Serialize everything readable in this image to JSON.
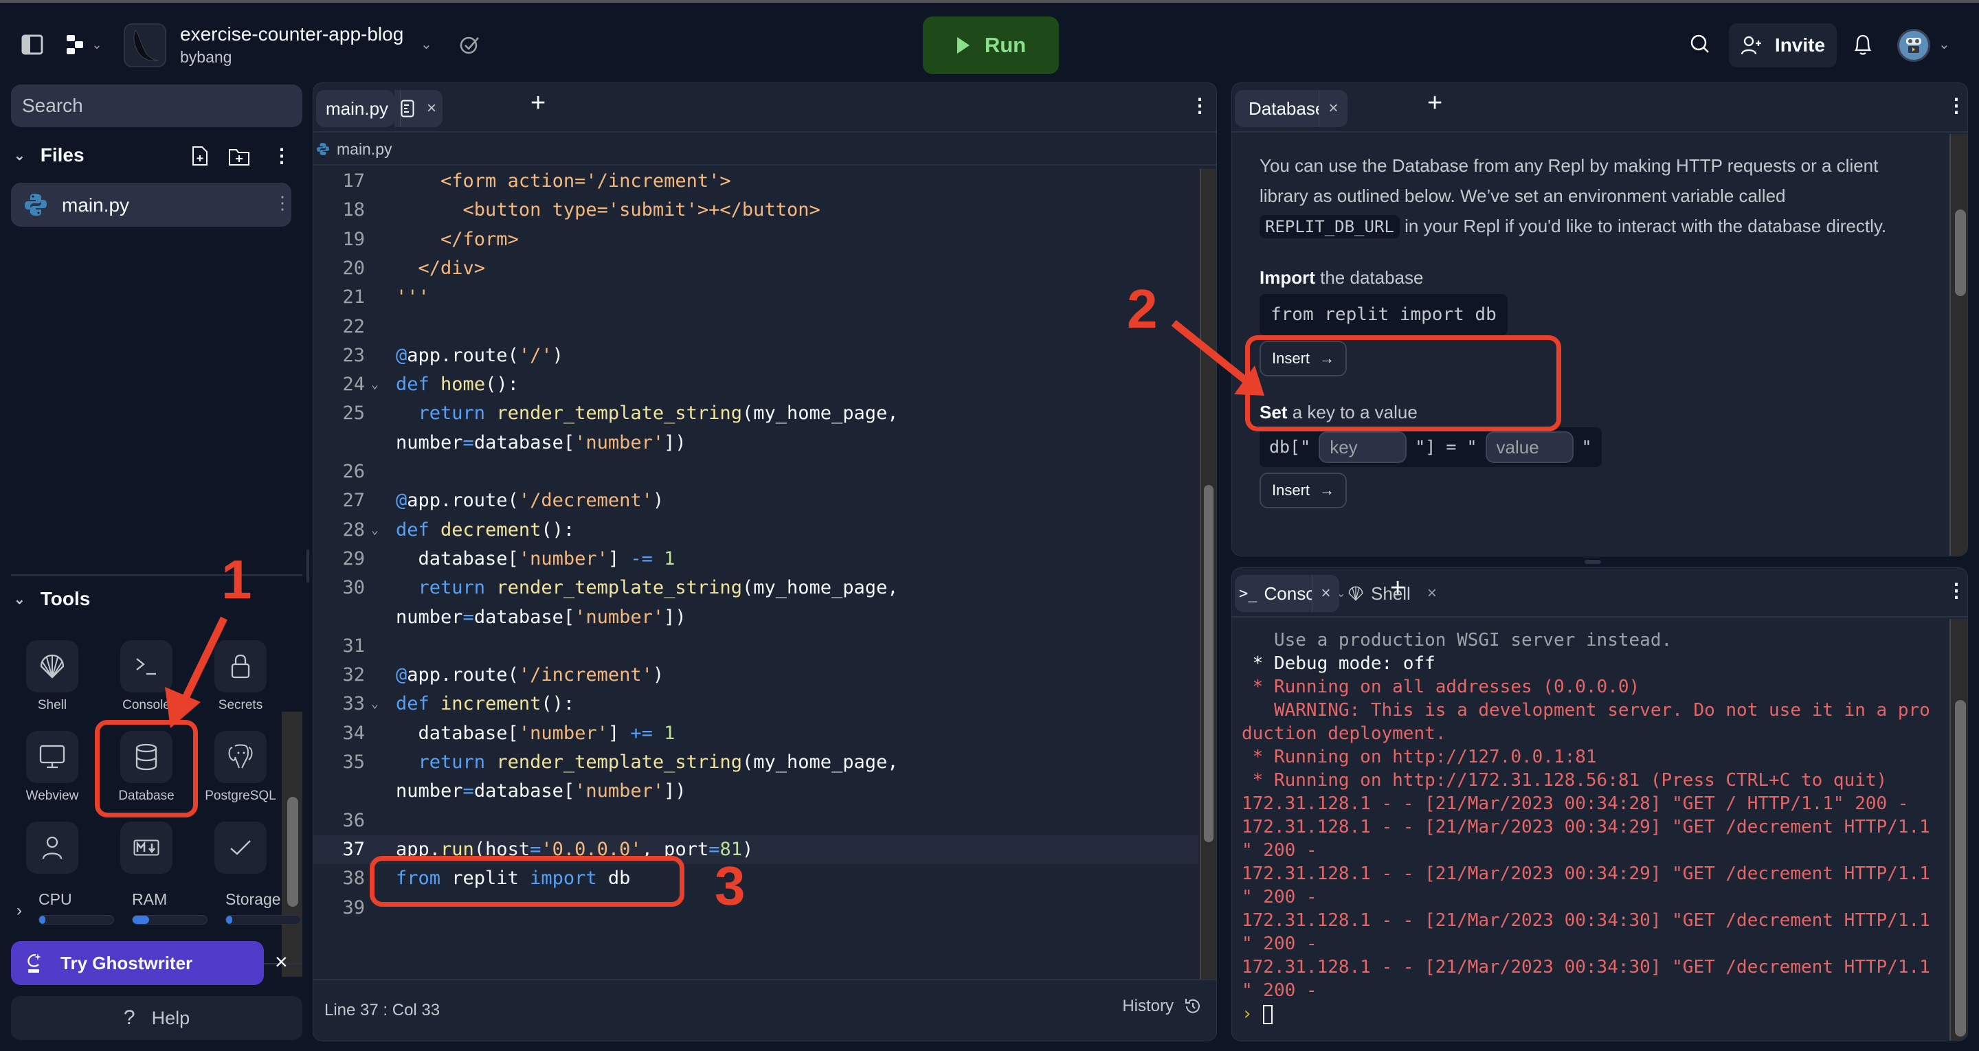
{
  "topbar": {
    "repl_title": "exercise-counter-app-blog",
    "repl_owner": "bybang",
    "run_label": "Run",
    "invite_label": "Invite",
    "icons": [
      "sidebar-toggle-icon",
      "replit-logo-icon",
      "chevron-down-icon",
      "flask-icon",
      "cloud-check-icon",
      "search-icon",
      "user-plus-icon",
      "bell-icon",
      "user-avatar"
    ]
  },
  "sidebar": {
    "search_placeholder": "Search",
    "files_heading": "Files",
    "files": [
      {
        "name": "main.py",
        "icon": "python-icon"
      }
    ],
    "tools_heading": "Tools",
    "tools": [
      {
        "label": "Shell",
        "icon": "shell-icon"
      },
      {
        "label": "Console",
        "icon": "terminal-icon"
      },
      {
        "label": "Secrets",
        "icon": "lock-icon"
      },
      {
        "label": "Webview",
        "icon": "monitor-icon"
      },
      {
        "label": "Database",
        "icon": "database-icon"
      },
      {
        "label": "PostgreSQL",
        "icon": "postgresql-icon"
      },
      {
        "label": "",
        "icon": "user-icon"
      },
      {
        "label": "",
        "icon": "markdown-icon"
      },
      {
        "label": "",
        "icon": "check-icon"
      }
    ],
    "resources": [
      {
        "label": "CPU",
        "percent": 3
      },
      {
        "label": "RAM",
        "percent": 22
      },
      {
        "label": "Storage",
        "percent": 3
      }
    ],
    "ghostwriter_label": "Try Ghostwriter",
    "help_label": "Help"
  },
  "editor": {
    "tab_label": "main.py",
    "breadcrumb": "main.py",
    "lines": [
      {
        "num": "17",
        "fold": "",
        "html": "    <span class=\"h\">&lt;form action='/increment'&gt;</span>"
      },
      {
        "num": "18",
        "fold": "",
        "html": "      <span class=\"h\">&lt;button type='submit'&gt;+&lt;/button&gt;</span>"
      },
      {
        "num": "19",
        "fold": "",
        "html": "    <span class=\"h\">&lt;/form&gt;</span>"
      },
      {
        "num": "20",
        "fold": "",
        "html": "  <span class=\"h\">&lt;/div&gt;</span>"
      },
      {
        "num": "21",
        "fold": "",
        "html": "<span class=\"h\">'''</span>"
      },
      {
        "num": "22",
        "fold": "",
        "html": ""
      },
      {
        "num": "23",
        "fold": "",
        "html": "<span class=\"k\">@</span>app.route(<span class=\"s\">'/'</span>)"
      },
      {
        "num": "24",
        "fold": "v",
        "html": "<span class=\"k\">def</span> <span class=\"f\">home</span>():"
      },
      {
        "num": "25",
        "fold": "",
        "html": "  <span class=\"k\">return</span> <span class=\"f\">render_template_string</span>(my_home_page,"
      },
      {
        "num": "",
        "fold": "",
        "html": "number<span class=\"op\">=</span>database[<span class=\"s\">'number'</span>])"
      },
      {
        "num": "26",
        "fold": "",
        "html": ""
      },
      {
        "num": "27",
        "fold": "",
        "html": "<span class=\"k\">@</span>app.route(<span class=\"s\">'/decrement'</span>)"
      },
      {
        "num": "28",
        "fold": "v",
        "html": "<span class=\"k\">def</span> <span class=\"f\">decrement</span>():"
      },
      {
        "num": "29",
        "fold": "",
        "html": "  database[<span class=\"s\">'number'</span>] <span class=\"op\">-=</span> <span class=\"n\">1</span>"
      },
      {
        "num": "30",
        "fold": "",
        "html": "  <span class=\"k\">return</span> <span class=\"f\">render_template_string</span>(my_home_page,"
      },
      {
        "num": "",
        "fold": "",
        "html": "number<span class=\"op\">=</span>database[<span class=\"s\">'number'</span>])"
      },
      {
        "num": "31",
        "fold": "",
        "html": ""
      },
      {
        "num": "32",
        "fold": "",
        "html": "<span class=\"k\">@</span>app.route(<span class=\"s\">'/increment'</span>)"
      },
      {
        "num": "33",
        "fold": "v",
        "html": "<span class=\"k\">def</span> <span class=\"f\">increment</span>():"
      },
      {
        "num": "34",
        "fold": "",
        "html": "  database[<span class=\"s\">'number'</span>] <span class=\"op\">+=</span> <span class=\"n\">1</span>"
      },
      {
        "num": "35",
        "fold": "",
        "html": "  <span class=\"k\">return</span> <span class=\"f\">render_template_string</span>(my_home_page,"
      },
      {
        "num": "",
        "fold": "",
        "html": "number<span class=\"op\">=</span>database[<span class=\"s\">'number'</span>])"
      },
      {
        "num": "36",
        "fold": "",
        "html": ""
      },
      {
        "num": "37",
        "fold": "",
        "html": "app.<span class=\"f\">run</span>(host<span class=\"op\">=</span><span class=\"s\">'0.0.0.0'</span>, port<span class=\"op\">=</span><span class=\"n\">81</span>)",
        "active": true
      },
      {
        "num": "38",
        "fold": "",
        "html": "<span class=\"k\">from</span> replit <span class=\"k\">import</span> db"
      },
      {
        "num": "39",
        "fold": "",
        "html": ""
      }
    ],
    "cursor_position": "Line 37 : Col 33",
    "history_label": "History"
  },
  "database": {
    "tab_label": "Database",
    "intro_part1": "You can use the Database from any Repl by making HTTP requests or a client library as outlined below. We’ve set an environment variable called",
    "env_var": "REPLIT_DB_URL",
    "intro_part2": "in your Repl if you'd like to interact with the database directly.",
    "import_bold": "Import",
    "import_rest": "the database",
    "import_code": "from replit import db",
    "insert_label": "Insert",
    "set_bold": "Set",
    "set_rest": "a key to a value",
    "set_prefix": "db[\"",
    "set_middle": "\"] = \"",
    "set_suffix": "\"",
    "key_placeholder": "key",
    "value_placeholder": "value"
  },
  "console": {
    "tab_label": "Console",
    "shell_tab_label": "Shell",
    "lines": [
      {
        "text": "   Use a production WSGI server instead.",
        "style": "dim"
      },
      {
        "text": " * Debug mode: off",
        "style": "white"
      },
      {
        "text": " * Running on all addresses (0.0.0.0)",
        "style": "red"
      },
      {
        "text": "   WARNING: This is a development server. Do not use it in a pro",
        "style": "red"
      },
      {
        "text": "duction deployment.",
        "style": "red"
      },
      {
        "text": " * Running on http://127.0.0.1:81",
        "style": "red"
      },
      {
        "text": " * Running on http://172.31.128.56:81 (Press CTRL+C to quit)",
        "style": "red"
      },
      {
        "text": "172.31.128.1 - - [21/Mar/2023 00:34:28] \"GET / HTTP/1.1\" 200 -",
        "style": "red"
      },
      {
        "text": "172.31.128.1 - - [21/Mar/2023 00:34:29] \"GET /decrement HTTP/1.1",
        "style": "red"
      },
      {
        "text": "\" 200 -",
        "style": "red"
      },
      {
        "text": "172.31.128.1 - - [21/Mar/2023 00:34:29] \"GET /decrement HTTP/1.1",
        "style": "red"
      },
      {
        "text": "\" 200 -",
        "style": "red"
      },
      {
        "text": "172.31.128.1 - - [21/Mar/2023 00:34:30] \"GET /decrement HTTP/1.1",
        "style": "red"
      },
      {
        "text": "\" 200 -",
        "style": "red"
      },
      {
        "text": "172.31.128.1 - - [21/Mar/2023 00:34:30] \"GET /decrement HTTP/1.1",
        "style": "red"
      },
      {
        "text": "\" 200 -",
        "style": "red"
      }
    ],
    "prompt": "›"
  },
  "annotations": {
    "step1": "1",
    "step2": "2",
    "step3": "3",
    "color": "#e8402a"
  },
  "colors": {
    "run_bg": "#1e4a19",
    "run_fg": "#8ae08a",
    "ghostwriter": "#4f3bc7",
    "console_error": "#e76565"
  }
}
